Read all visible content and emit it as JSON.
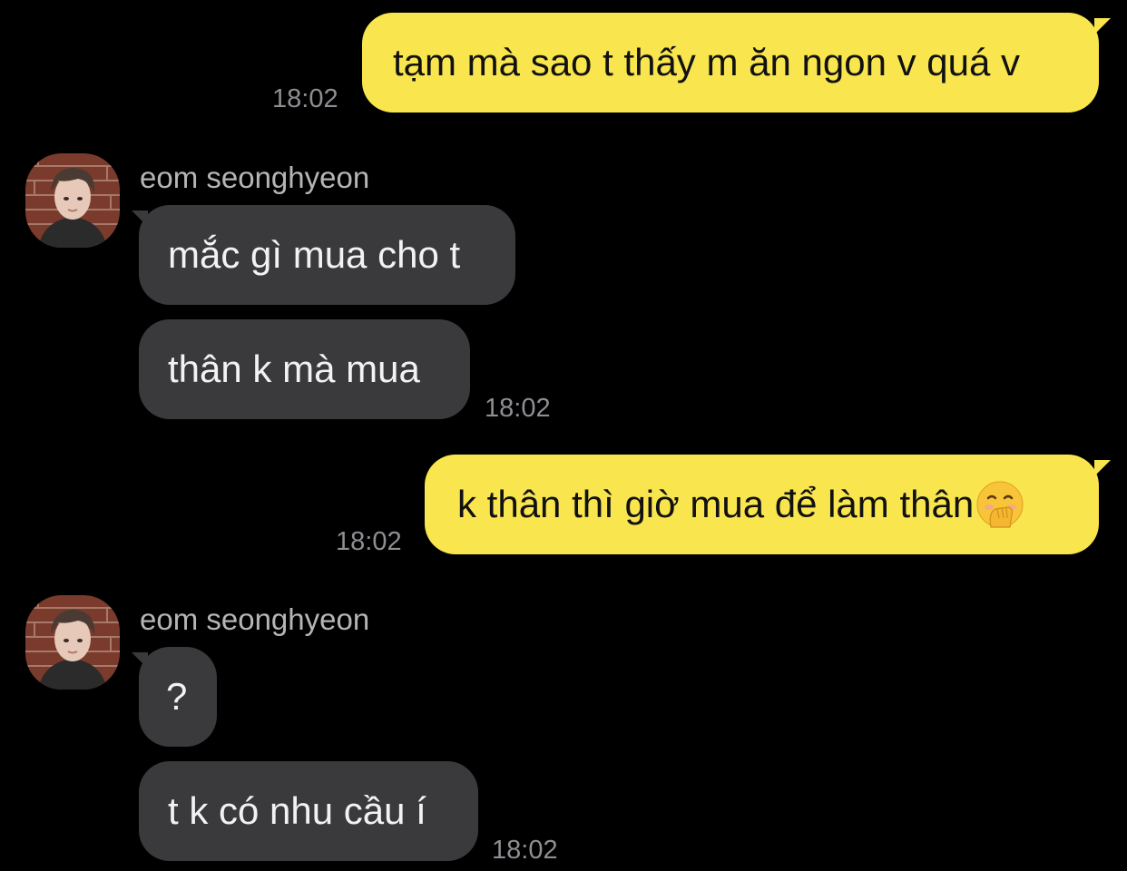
{
  "conversation": {
    "sender_name": "eom seonghyeon",
    "colors": {
      "background": "#000000",
      "outgoing_bubble": "#f9e54e",
      "incoming_bubble": "#3a3a3c",
      "timestamp": "#8e8e93",
      "sender_name": "#b5b5b8"
    },
    "messages": [
      {
        "direction": "outgoing",
        "text": "tạm mà sao t thấy m ăn ngon v quá v",
        "time": "18:02"
      },
      {
        "direction": "incoming",
        "text": "mắc gì mua cho t"
      },
      {
        "direction": "incoming",
        "text": "thân k mà mua",
        "time": "18:02"
      },
      {
        "direction": "outgoing",
        "text": "k thân thì giờ mua để làm thân",
        "emoji": "face-with-hand-over-mouth-icon",
        "time": "18:02"
      },
      {
        "direction": "incoming",
        "text": "?"
      },
      {
        "direction": "incoming",
        "text": "t k có nhu cầu í",
        "time": "18:02"
      }
    ]
  }
}
